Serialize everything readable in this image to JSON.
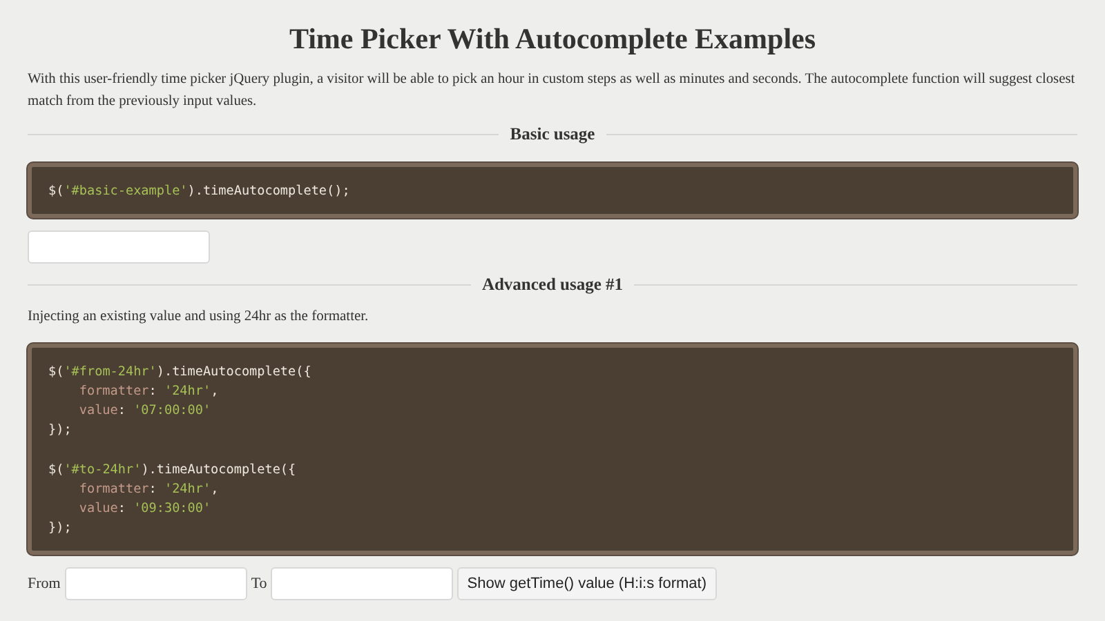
{
  "title": "Time Picker With Autocomplete Examples",
  "intro": "With this user-friendly time picker jQuery plugin, a visitor will be able to pick an hour in custom steps as well as minutes and seconds. The autocomplete function will suggest closest match from the previously input values.",
  "sections": [
    {
      "heading": "Basic usage",
      "code": [
        [
          [
            {
              "kind": "plain",
              "text": "$("
            },
            {
              "kind": "string",
              "text": "'#basic-example'"
            },
            {
              "kind": "plain",
              "text": ").timeAutocomplete();"
            }
          ]
        ]
      ],
      "fields": [
        {
          "kind": "time"
        }
      ]
    },
    {
      "heading": "Advanced usage #1",
      "description": "Injecting an existing value and using 24hr as the formatter.",
      "code": [
        [
          [
            {
              "kind": "plain",
              "text": "$("
            },
            {
              "kind": "string",
              "text": "'#from-24hr'"
            },
            {
              "kind": "plain",
              "text": ").timeAutocomplete({"
            }
          ],
          [
            {
              "kind": "key",
              "text": "    formatter"
            },
            {
              "kind": "plain",
              "text": ": "
            },
            {
              "kind": "string",
              "text": "'24hr'"
            },
            {
              "kind": "plain",
              "text": ","
            }
          ],
          [
            {
              "kind": "key",
              "text": "    value"
            },
            {
              "kind": "plain",
              "text": ": "
            },
            {
              "kind": "string",
              "text": "'07:00:00'"
            }
          ],
          [
            {
              "kind": "plain",
              "text": "});"
            }
          ]
        ],
        [
          [
            {
              "kind": "plain",
              "text": "$("
            },
            {
              "kind": "string",
              "text": "'#to-24hr'"
            },
            {
              "kind": "plain",
              "text": ").timeAutocomplete({"
            }
          ],
          [
            {
              "kind": "key",
              "text": "    formatter"
            },
            {
              "kind": "plain",
              "text": ": "
            },
            {
              "kind": "string",
              "text": "'24hr'"
            },
            {
              "kind": "plain",
              "text": ","
            }
          ],
          [
            {
              "kind": "key",
              "text": "    value"
            },
            {
              "kind": "plain",
              "text": ": "
            },
            {
              "kind": "string",
              "text": "'09:30:00'"
            }
          ],
          [
            {
              "kind": "plain",
              "text": "});"
            }
          ]
        ]
      ],
      "fields": [
        {
          "kind": "time",
          "label": "From"
        },
        {
          "kind": "time",
          "label": "To"
        }
      ],
      "button": "Show getTime() value (H:i:s format)"
    }
  ]
}
